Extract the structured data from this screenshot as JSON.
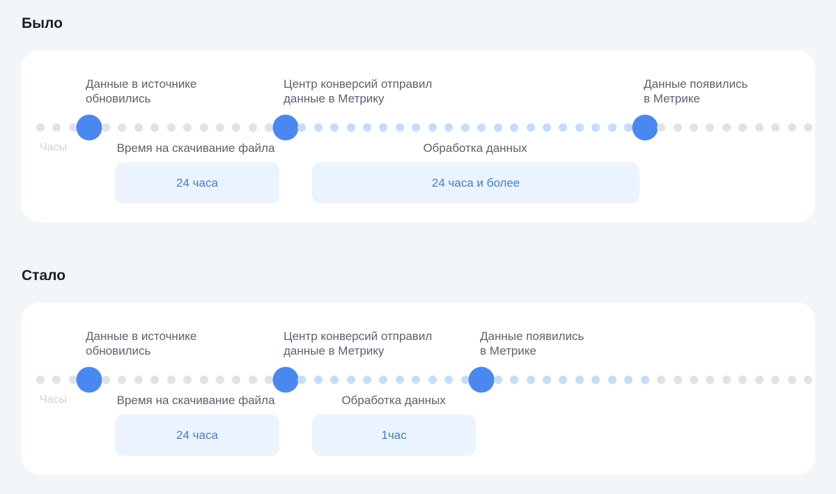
{
  "before": {
    "title": "Было",
    "hours_label": "Часы",
    "events": [
      {
        "label": "Данные в источнике\nобновились"
      },
      {
        "label": "Центр конверсий отправил\nданные в Метрику"
      },
      {
        "label": "Данные появились\nв Метрике"
      }
    ],
    "phases": [
      {
        "label": "Время на скачивание файла",
        "duration": "24 часа"
      },
      {
        "label": "Обработка данных",
        "duration": "24 часа и более"
      }
    ]
  },
  "after": {
    "title": "Стало",
    "hours_label": "Часы",
    "events": [
      {
        "label": "Данные в источнике\nобновились"
      },
      {
        "label": "Центр конверсий отправил\nданные в Метрику"
      },
      {
        "label": "Данные появились\nв Метрике"
      }
    ],
    "phases": [
      {
        "label": "Время на скачивание файла",
        "duration": "24 часа"
      },
      {
        "label": "Обработка данных",
        "duration": "1час"
      }
    ]
  },
  "colors": {
    "node": "#4a87f0",
    "dot_inactive": "#dfe2e8",
    "dot_processing": "#c6dcfb",
    "duration_box": "#eaf3fe",
    "duration_text": "#3f7fe0"
  }
}
